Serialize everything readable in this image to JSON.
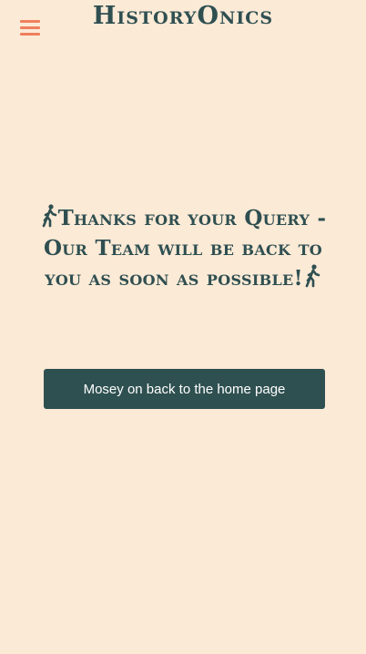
{
  "header": {
    "menu_icon": "hamburger-icon",
    "brand": "HistoryOnics"
  },
  "main": {
    "message": "Thanks for your Query - Our Team will be back to you as soon as possible!",
    "walker_icon": "person-walking-icon",
    "home_button_label": "Mosey on back to the home page"
  },
  "colors": {
    "background": "#fbead6",
    "text": "#2f4f51",
    "menu_accent": "#ef7f5d",
    "button_bg": "#2f5051",
    "button_text": "#ffffff"
  }
}
